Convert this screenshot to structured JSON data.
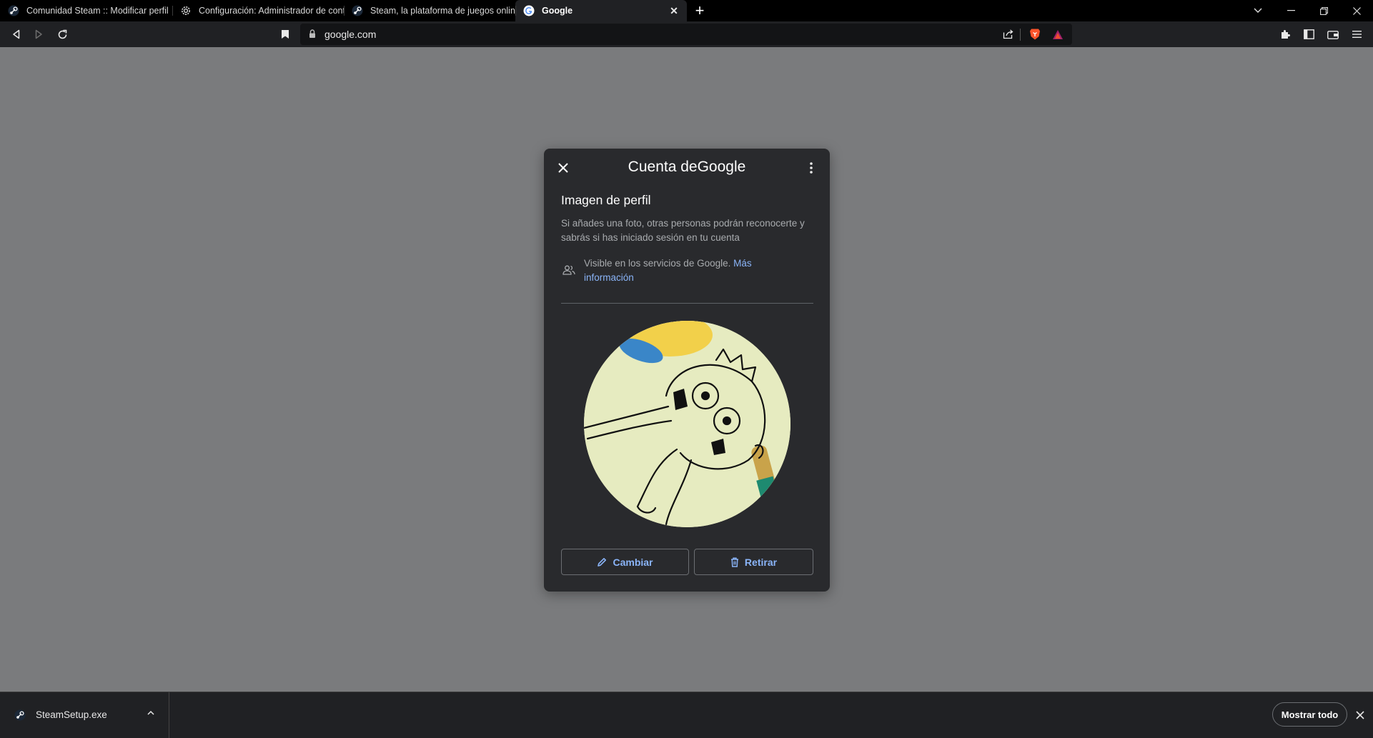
{
  "tabs": [
    {
      "title": "Comunidad Steam :: Modificar perfil",
      "favicon": "steam-icon"
    },
    {
      "title": "Configuración: Administrador de cont",
      "favicon": "gear-icon"
    },
    {
      "title": "Steam, la plataforma de juegos online",
      "favicon": "steam-icon"
    },
    {
      "title": "Google",
      "favicon": "google-icon",
      "active": true
    }
  ],
  "address_bar": {
    "url": "google.com"
  },
  "dialog": {
    "title": "Cuenta deGoogle",
    "heading": "Imagen de perfil",
    "description": "Si añades una foto, otras personas podrán reconocerte y sabrás si has iniciado sesión en tu cuenta",
    "visibility_text": "Visible en los servicios de Google.",
    "visibility_link": "Más información",
    "change_button": "Cambiar",
    "remove_button": "Retirar"
  },
  "download_bar": {
    "file_name": "SteamSetup.exe",
    "show_all": "Mostrar todo"
  },
  "colors": {
    "link": "#8ab4f8",
    "dialog_bg": "#292a2d",
    "overlay": "#7a7b7d",
    "brave_orange": "#fb542b"
  }
}
